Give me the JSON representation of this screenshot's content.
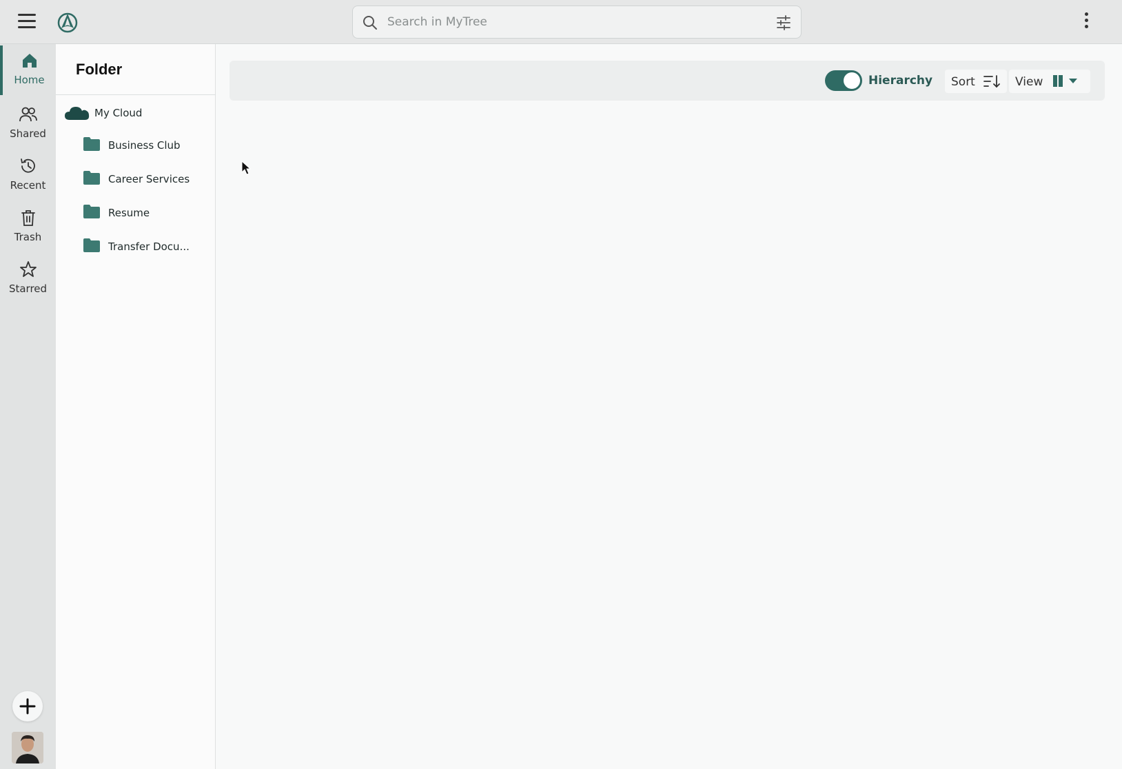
{
  "topbar": {
    "search_placeholder": "Search in MyTree"
  },
  "rail": {
    "items": [
      {
        "label": "Home",
        "icon": "home-icon"
      },
      {
        "label": "Shared",
        "icon": "people-icon"
      },
      {
        "label": "Recent",
        "icon": "history-icon"
      },
      {
        "label": "Trash",
        "icon": "trash-icon"
      },
      {
        "label": "Starred",
        "icon": "star-icon"
      }
    ],
    "active": "Home"
  },
  "folder_panel": {
    "title": "Folder",
    "root": "My Cloud",
    "folders": [
      "Business Club",
      "Career Services",
      "Resume",
      "Transfer Docu..."
    ]
  },
  "toolbar": {
    "hierarchy_label": "Hierarchy",
    "hierarchy_on": true,
    "sort_label": "Sort",
    "view_label": "View"
  },
  "colors": {
    "accent": "#2f6b64",
    "folder": "#3d7a72",
    "cloud": "#1e4a46"
  }
}
